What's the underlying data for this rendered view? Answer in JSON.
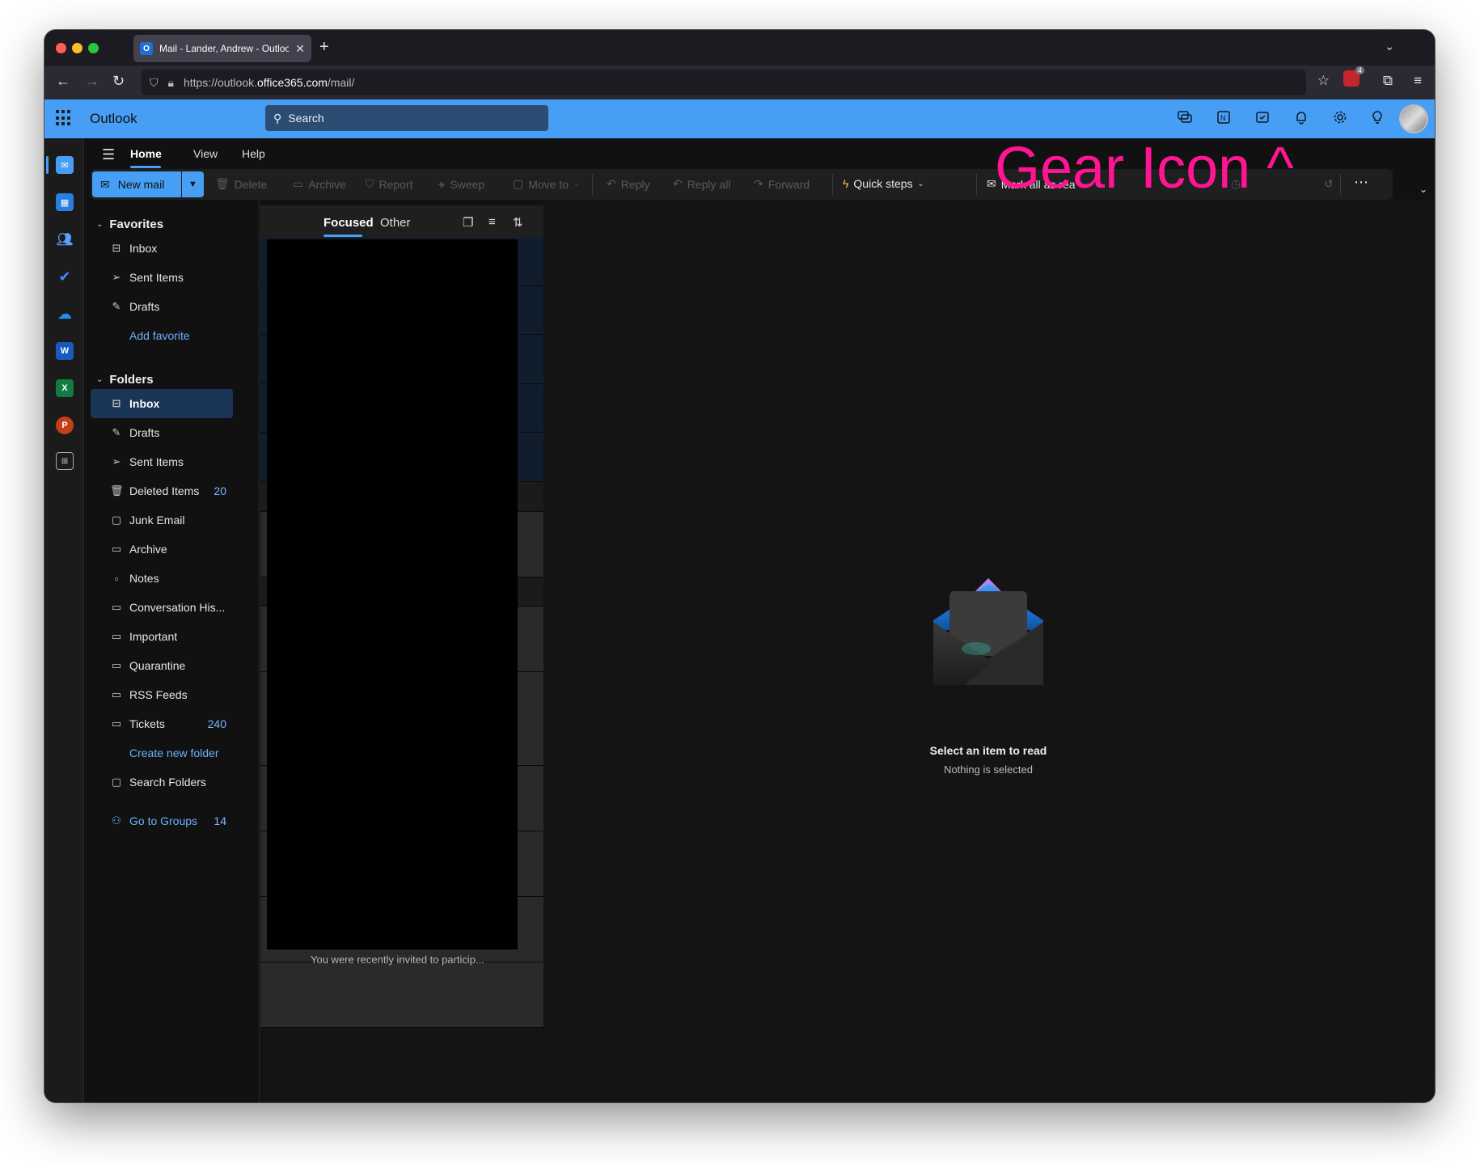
{
  "browser": {
    "tab_title": "Mail - Lander, Andrew - Outlook",
    "tab_favicon": "O",
    "url_prefix": "https://outlook.",
    "url_host": "office365.com",
    "url_path": "/mail/",
    "extension_badge": "4"
  },
  "header": {
    "app_name": "Outlook",
    "search_placeholder": "Search"
  },
  "menu": {
    "tabs": [
      "Home",
      "View",
      "Help"
    ]
  },
  "ribbon": {
    "new_mail": "New mail",
    "delete": "Delete",
    "archive": "Archive",
    "report": "Report",
    "sweep": "Sweep",
    "move_to": "Move to",
    "reply": "Reply",
    "reply_all": "Reply all",
    "forward": "Forward",
    "quick_steps": "Quick steps",
    "mark_all_read": "Mark all as rea"
  },
  "annotation": "Gear Icon ^",
  "favorites": {
    "title": "Favorites",
    "items": [
      {
        "label": "Inbox",
        "icon": "inbox-icon"
      },
      {
        "label": "Sent Items",
        "icon": "send-icon"
      },
      {
        "label": "Drafts",
        "icon": "pencil-icon"
      }
    ],
    "add_label": "Add favorite"
  },
  "folders": {
    "title": "Folders",
    "items": [
      {
        "label": "Inbox",
        "count": ""
      },
      {
        "label": "Drafts",
        "count": ""
      },
      {
        "label": "Sent Items",
        "count": ""
      },
      {
        "label": "Deleted Items",
        "count": "20"
      },
      {
        "label": "Junk Email",
        "count": ""
      },
      {
        "label": "Archive",
        "count": ""
      },
      {
        "label": "Notes",
        "count": ""
      },
      {
        "label": "Conversation His...",
        "count": ""
      },
      {
        "label": "Important",
        "count": ""
      },
      {
        "label": "Quarantine",
        "count": ""
      },
      {
        "label": "RSS Feeds",
        "count": ""
      },
      {
        "label": "Tickets",
        "count": "240"
      }
    ],
    "create_label": "Create new folder",
    "search_folders": "Search Folders",
    "groups_label": "Go to Groups",
    "groups_count": "14"
  },
  "message_list": {
    "tab_focused": "Focused",
    "tab_other": "Other",
    "last_preview": "You were recently invited to particip..."
  },
  "reading_pane": {
    "title": "Select an item to read",
    "subtitle": "Nothing is selected"
  },
  "colors": {
    "accent": "#479ef5",
    "annotation": "#ff1493",
    "selected_folder": "#1a3555"
  }
}
